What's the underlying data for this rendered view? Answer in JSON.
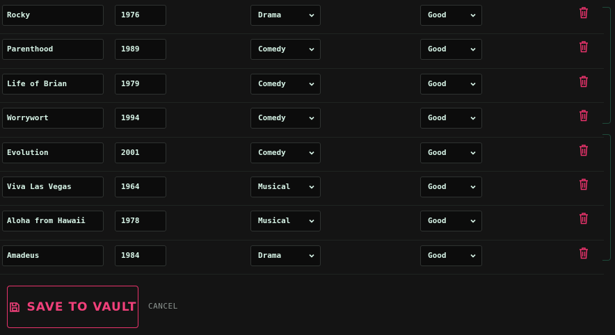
{
  "movies": [
    {
      "title": "Rocky",
      "year": "1976",
      "genre": "Drama",
      "rating": "Good"
    },
    {
      "title": "Parenthood",
      "year": "1989",
      "genre": "Comedy",
      "rating": "Good"
    },
    {
      "title": "Life of Brian",
      "year": "1979",
      "genre": "Comedy",
      "rating": "Good"
    },
    {
      "title": "Worrywort",
      "year": "1994",
      "genre": "Comedy",
      "rating": "Good"
    },
    {
      "title": "Evolution",
      "year": "2001",
      "genre": "Comedy",
      "rating": "Good"
    },
    {
      "title": "Viva Las Vegas",
      "year": "1964",
      "genre": "Musical",
      "rating": "Good"
    },
    {
      "title": "Aloha from Hawaii",
      "year": "1978",
      "genre": "Musical",
      "rating": "Good"
    },
    {
      "title": "Amadeus",
      "year": "1984",
      "genre": "Drama",
      "rating": "Good"
    }
  ],
  "actions": {
    "save_label": "SAVE TO VAULT",
    "cancel_label": "CANCEL"
  },
  "icons": {
    "delete": "trash-icon",
    "save": "floppy-disk-icon",
    "dropdown": "chevron-down-icon"
  },
  "colors": {
    "background": "#141414",
    "text": "#d6f3e6",
    "accent": "#f0407a",
    "delete": "#e8336b",
    "side_accent": "#1e4a3a"
  }
}
